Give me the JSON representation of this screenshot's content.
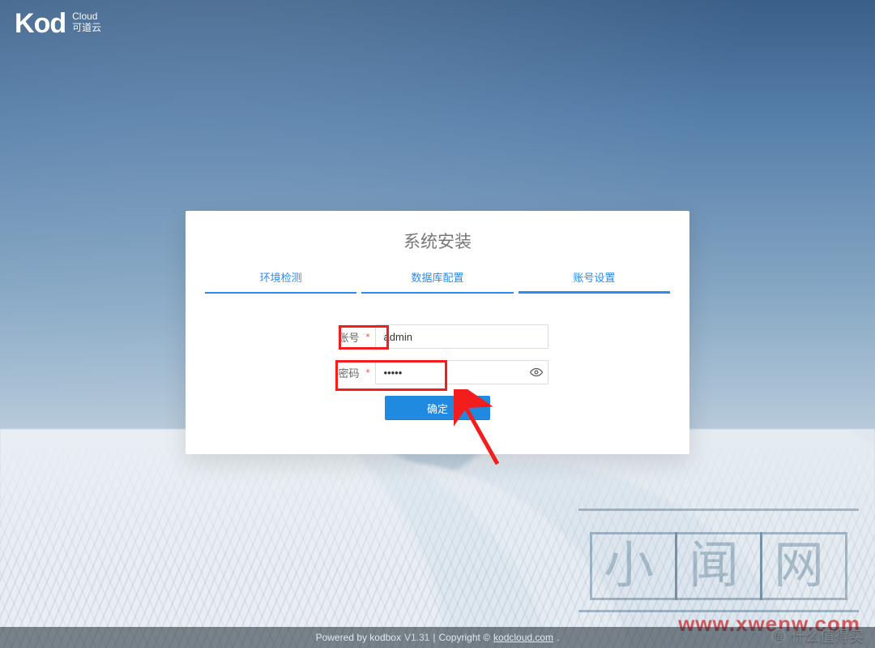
{
  "logo": {
    "main": "Kod",
    "cloud_en": "Cloud",
    "cloud_zh": "可道云"
  },
  "card": {
    "title": "系统安装",
    "steps": [
      "环境检测",
      "数据库配置",
      "账号设置"
    ],
    "active_step_index": 2,
    "username_label": "账号",
    "password_label": "密码",
    "required_mark": "*",
    "username_value": "admin",
    "password_value": "•••••",
    "submit_label": "确定"
  },
  "footer": {
    "powered_prefix": "Powered by kodbox",
    "version": "V1.31",
    "separator": "|",
    "copyright_prefix": "Copyright ©",
    "site": "kodcloud.com",
    "suffix": "."
  },
  "watermark": {
    "brand_chars": [
      "小",
      "闻",
      "网"
    ],
    "url": "www.xwenw.com",
    "bottom_right_text": "什么值得买"
  }
}
